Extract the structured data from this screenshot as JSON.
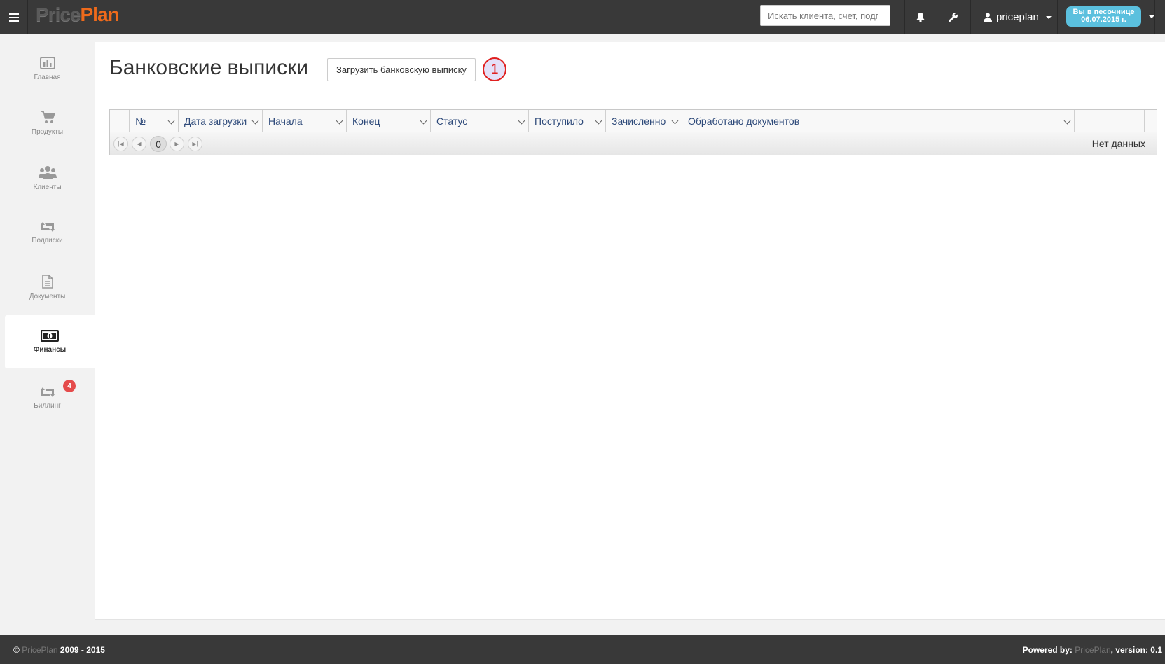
{
  "header": {
    "logo_part1": "Price",
    "logo_part2": "Plan",
    "search_placeholder": "Искать клиента, счет, подг",
    "user_name": "priceplan",
    "sandbox_line1": "Вы в песочнице",
    "sandbox_line2": "06.07.2015 г.",
    "icons": [
      "menu-icon",
      "bell-icon",
      "wrench-icon",
      "user-icon"
    ]
  },
  "sidebar": {
    "items": [
      {
        "label": "Главная",
        "icon": "chart-icon"
      },
      {
        "label": "Продукты",
        "icon": "cart-icon"
      },
      {
        "label": "Клиенты",
        "icon": "users-icon"
      },
      {
        "label": "Подписки",
        "icon": "retweet-icon"
      },
      {
        "label": "Документы",
        "icon": "document-icon"
      },
      {
        "label": "Финансы",
        "icon": "money-icon",
        "active": true
      },
      {
        "label": "Биллинг",
        "icon": "retweet-icon",
        "badge": "4"
      }
    ]
  },
  "main": {
    "title": "Банковские выписки",
    "upload_button": "Загрузить банковскую выписку",
    "marker": "1",
    "columns": [
      "№",
      "Дата загрузки",
      "Начала",
      "Конец",
      "Статус",
      "Поступило",
      "Зачисленно",
      "Обработано документов"
    ],
    "pager": {
      "page": "0",
      "empty_text": "Нет данных"
    }
  },
  "footer": {
    "copyright_symbol": "©",
    "brand": "PricePlan",
    "years": "2009 - 2015",
    "powered_label": "Powered by:",
    "powered_brand": "PricePlan",
    "version_text": ", version: 0.1"
  },
  "colors": {
    "topbar": "#393939",
    "logo_accent": "#ee6a1b",
    "sandbox": "#5bc0de",
    "badge": "#e54b4b",
    "column_text": "#2e4a7a"
  }
}
